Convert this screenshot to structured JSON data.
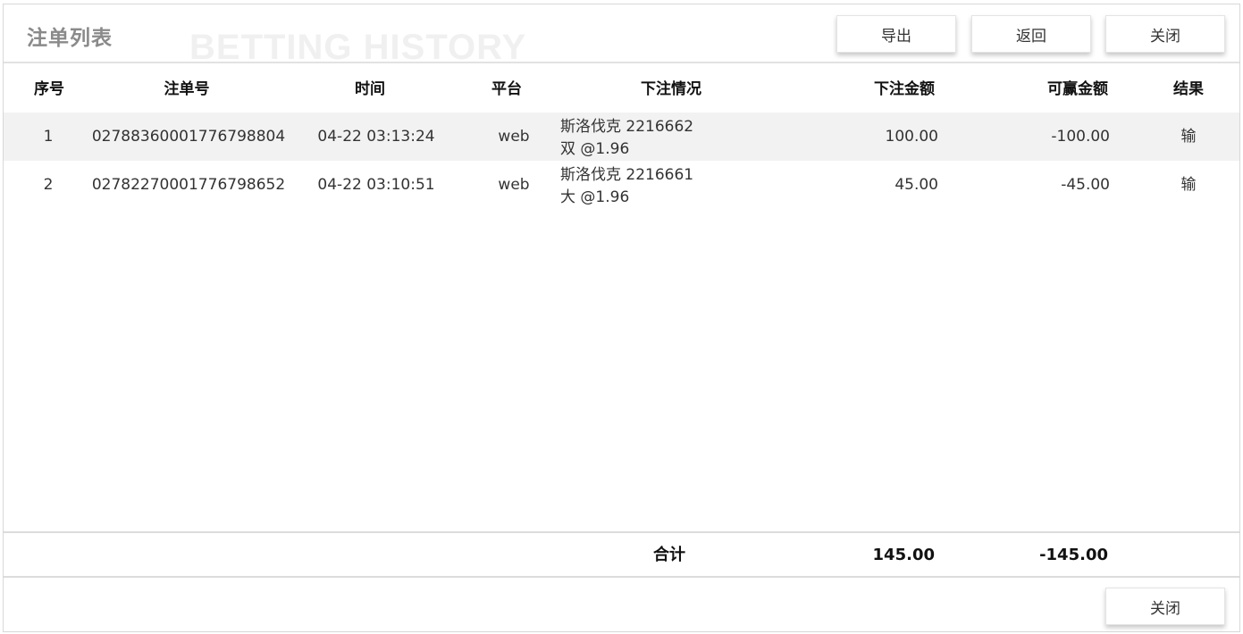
{
  "header": {
    "title": "注单列表",
    "watermark": "BETTING HISTORY",
    "buttons": {
      "export": "导出",
      "back": "返回",
      "close": "关闭"
    }
  },
  "table": {
    "columns": {
      "index": "序号",
      "order_no": "注单号",
      "time": "时间",
      "platform": "平台",
      "detail": "下注情况",
      "bet_amount": "下注金额",
      "win_amount": "可赢金额",
      "result": "结果"
    },
    "rows": [
      {
        "index": "1",
        "order_no": "02788360001776798804",
        "time": "04-22 03:13:24",
        "platform": "web",
        "detail_line1": "斯洛伐克 2216662",
        "detail_line2": "双 @1.96",
        "bet_amount": "100.00",
        "win_amount": "-100.00",
        "result": "输"
      },
      {
        "index": "2",
        "order_no": "02782270001776798652",
        "time": "04-22 03:10:51",
        "platform": "web",
        "detail_line1": "斯洛伐克 2216661",
        "detail_line2": "大 @1.96",
        "bet_amount": "45.00",
        "win_amount": "-45.00",
        "result": "输"
      }
    ]
  },
  "totals": {
    "label": "合计",
    "bet_amount": "145.00",
    "win_amount": "-145.00"
  },
  "footer": {
    "close": "关闭"
  }
}
